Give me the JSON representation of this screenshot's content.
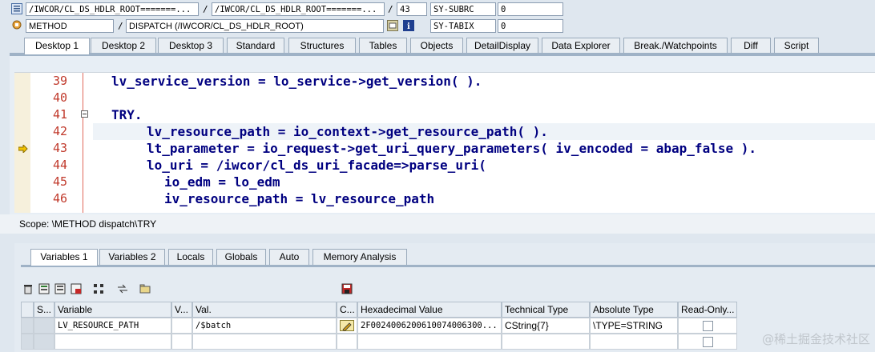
{
  "header": {
    "row1": {
      "field1": "/IWCOR/CL_DS_HDLR_ROOT=======...",
      "field2": "/IWCOR/CL_DS_HDLR_ROOT=======...",
      "line_no": "43",
      "sys_field": "SY-SUBRC",
      "sys_value": "0"
    },
    "row2": {
      "type": "METHOD",
      "name": "DISPATCH (/IWCOR/CL_DS_HDLR_ROOT)",
      "sys_field": "SY-TABIX",
      "sys_value": "0"
    },
    "separator": "/"
  },
  "top_tabs": [
    "Desktop 1",
    "Desktop 2",
    "Desktop 3",
    "Standard",
    "Structures",
    "Tables",
    "Objects",
    "DetailDisplay",
    "Data Explorer",
    "Break./Watchpoints",
    "Diff",
    "Script"
  ],
  "editor": {
    "lines": [
      {
        "num": "39",
        "code": "lv_service_version = lo_service->get_version( )."
      },
      {
        "num": "40",
        "code": ""
      },
      {
        "num": "41",
        "code": "TRY."
      },
      {
        "num": "42",
        "code": "lv_resource_path = io_context->get_resource_path( )."
      },
      {
        "num": "43",
        "code": "lt_parameter = io_request->get_uri_query_parameters( iv_encoded = abap_false )."
      },
      {
        "num": "44",
        "code": "lo_uri = /iwcor/cl_ds_uri_facade=>parse_uri("
      },
      {
        "num": "45",
        "code": "io_edm = lo_edm"
      },
      {
        "num": "46",
        "code": "iv_resource_path = lv_resource_path"
      }
    ]
  },
  "scope": "Scope: \\METHOD dispatch\\TRY",
  "bottom_tabs": [
    "Variables 1",
    "Variables 2",
    "Locals",
    "Globals",
    "Auto",
    "Memory Analysis"
  ],
  "grid": {
    "headers": [
      "S...",
      "Variable",
      "V...",
      "Val.",
      "C...",
      "Hexadecimal Value",
      "Technical Type",
      "Absolute Type",
      "Read-Only..."
    ],
    "rows": [
      {
        "variable": "LV_RESOURCE_PATH",
        "value": "/$batch",
        "hex": "2F0024006200610074006300...",
        "tech": "CString{7}",
        "abs": "\\TYPE=STRING"
      }
    ]
  },
  "watermark": "@稀土掘金技术社区",
  "colors": {
    "accent": "#c0392b",
    "bg": "#dfe7ef"
  }
}
